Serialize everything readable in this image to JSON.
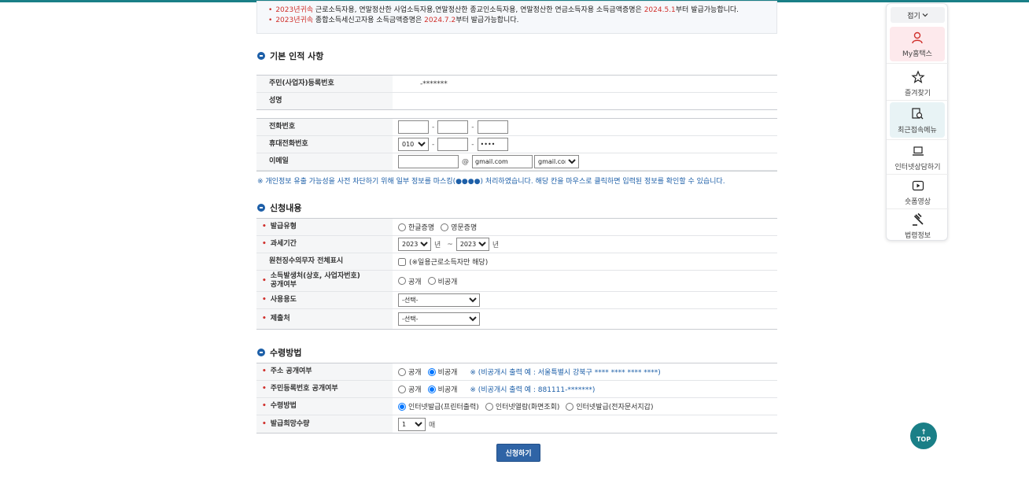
{
  "notice": {
    "items": [
      {
        "prefix": "2023년귀속",
        "text": " 근로소득자용, 연말정산한 사업소득자용,연말정산한 종교인소득자용, 연말정산한 연금소득자용 소득금액증명은 ",
        "date": "2024.5.1",
        "suffix": "부터 발급가능합니다."
      },
      {
        "prefix": "2023년귀속",
        "text": " 종합소득세신고자용 소득금액증명은 ",
        "date": "2024.7.2",
        "suffix": "부터 발급가능합니다."
      }
    ]
  },
  "basic": {
    "title": "기본 인적 사항",
    "rrn_label": "주민(사업자)등록번호",
    "rrn_value": "-*******",
    "name_label": "성명",
    "name_value": "",
    "phone_label": "전화번호",
    "mobile_label": "휴대전화번호",
    "mobile_prefix": "010",
    "mobile_last": "••••",
    "email_label": "이메일",
    "email_at": "@",
    "email_domain": "gmail.com",
    "email_select": "gmail.com",
    "dash": "-",
    "mask_note": "※ 개인정보 유출 가능성을 사전 차단하기 위해 일부 정보를 마스킹(●●●●) 처리하였습니다. 해당 칸을 마우스로 클릭하면 입력된 정보를 확인할 수 있습니다."
  },
  "apply": {
    "title": "신청내용",
    "type_label": "발급유형",
    "type_opt1": "한글증명",
    "type_opt2": "영문증명",
    "period_label": "과세기간",
    "year_from": "2023",
    "year_to": "2023",
    "year_unit": "년",
    "tilde": "~",
    "withholding_label": "원천징수의무자 전체표시",
    "withholding_note": "(※일용근로소득자만 해당)",
    "disclose_label": "소득발생처(상호, 사업자번호) 공개여부",
    "disclose_opt1": "공개",
    "disclose_opt2": "비공개",
    "usage_label": "사용용도",
    "usage_select": "-선택-",
    "submit_to_label": "제출처",
    "submit_to_select": "-선택-"
  },
  "receive": {
    "title": "수령방법",
    "addr_label": "주소 공개여부",
    "addr_opt1": "공개",
    "addr_opt2": "비공개",
    "addr_hint": "※ (비공개시 출력 예 : 서울특별시 강북구 **** **** **** ****)",
    "rrn_label": "주민등록번호 공개여부",
    "rrn_opt1": "공개",
    "rrn_opt2": "비공개",
    "rrn_hint": "※ (비공개시 출력 예 : 881111-*******)",
    "method_label": "수령방법",
    "method_opt1": "인터넷발급(프린터출력)",
    "method_opt2": "인터넷열람(화면조회)",
    "method_opt3": "인터넷발급(전자문서지갑)",
    "qty_label": "발급희망수량",
    "qty_value": "1",
    "qty_unit": "매"
  },
  "submit_label": "신청하기",
  "quick": {
    "fold": "접기",
    "items": [
      "My홈택스",
      "즐겨찾기",
      "최근접속메뉴",
      "인터넷상담하기",
      "숏폼영상",
      "법령정보"
    ]
  },
  "top_label": "TOP",
  "colors": {
    "accent": "#1a7f87",
    "primary": "#2f64a6",
    "required": "#d0312d",
    "hint": "#1d5fa8"
  }
}
